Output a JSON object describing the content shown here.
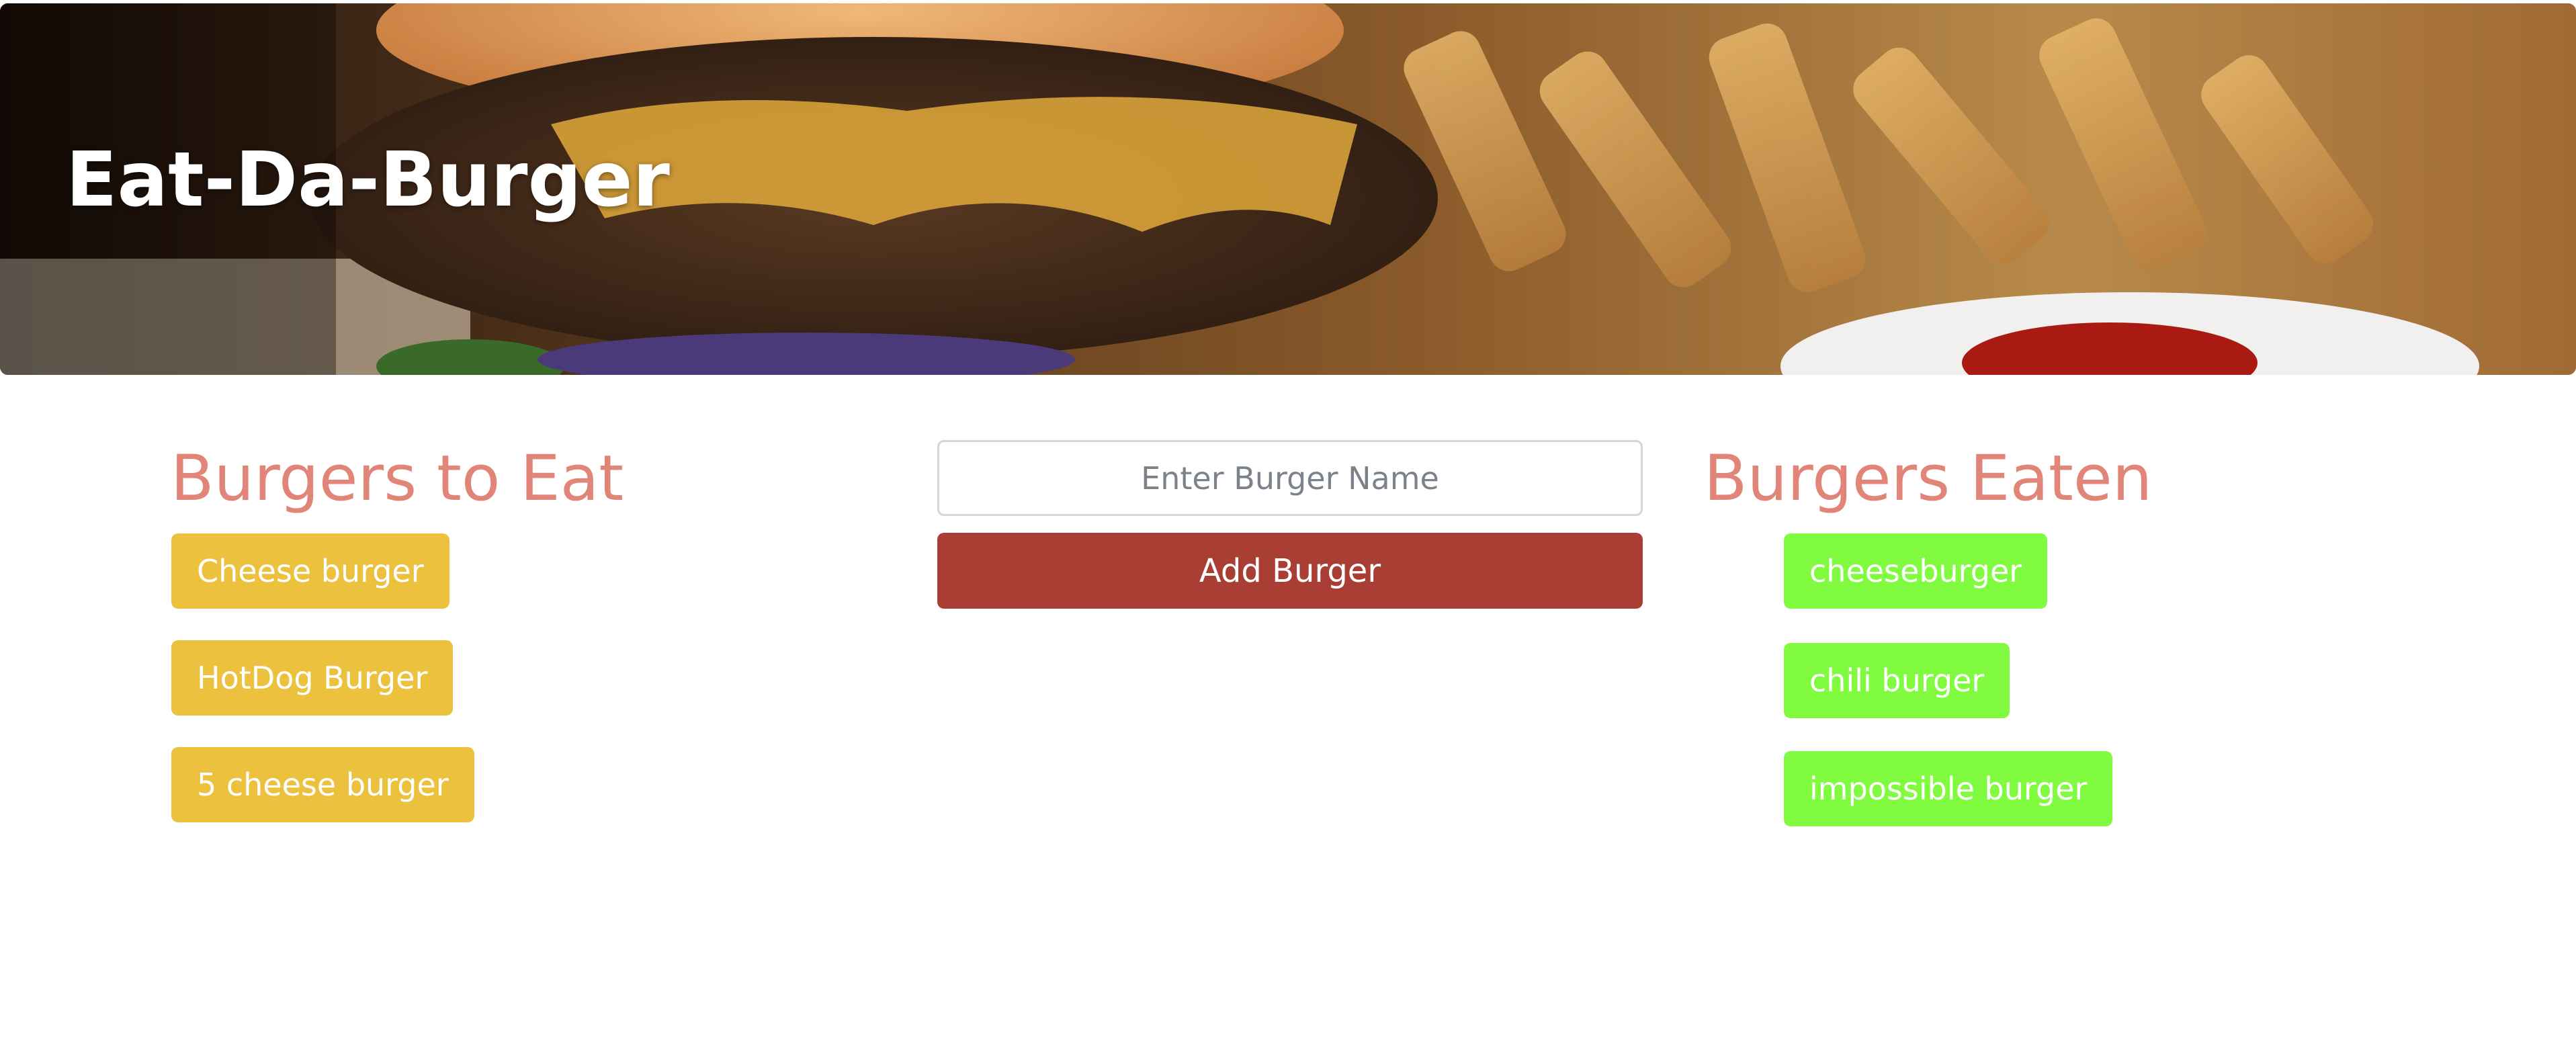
{
  "header": {
    "title": "Eat-Da-Burger"
  },
  "to_eat": {
    "title": "Burgers to Eat",
    "items": [
      {
        "label": "Cheese burger"
      },
      {
        "label": "HotDog Burger"
      },
      {
        "label": "5 cheese burger"
      }
    ]
  },
  "form": {
    "placeholder": "Enter Burger Name",
    "value": "",
    "submit_label": "Add Burger"
  },
  "eaten": {
    "title": "Burgers Eaten",
    "items": [
      {
        "label": "cheeseburger"
      },
      {
        "label": "chili burger"
      },
      {
        "label": "impossible burger"
      }
    ]
  },
  "colors": {
    "heading": "#e08577",
    "to_eat_button": "#ebc13e",
    "eaten_button": "#80fb3f",
    "submit_button": "#a93f34"
  }
}
